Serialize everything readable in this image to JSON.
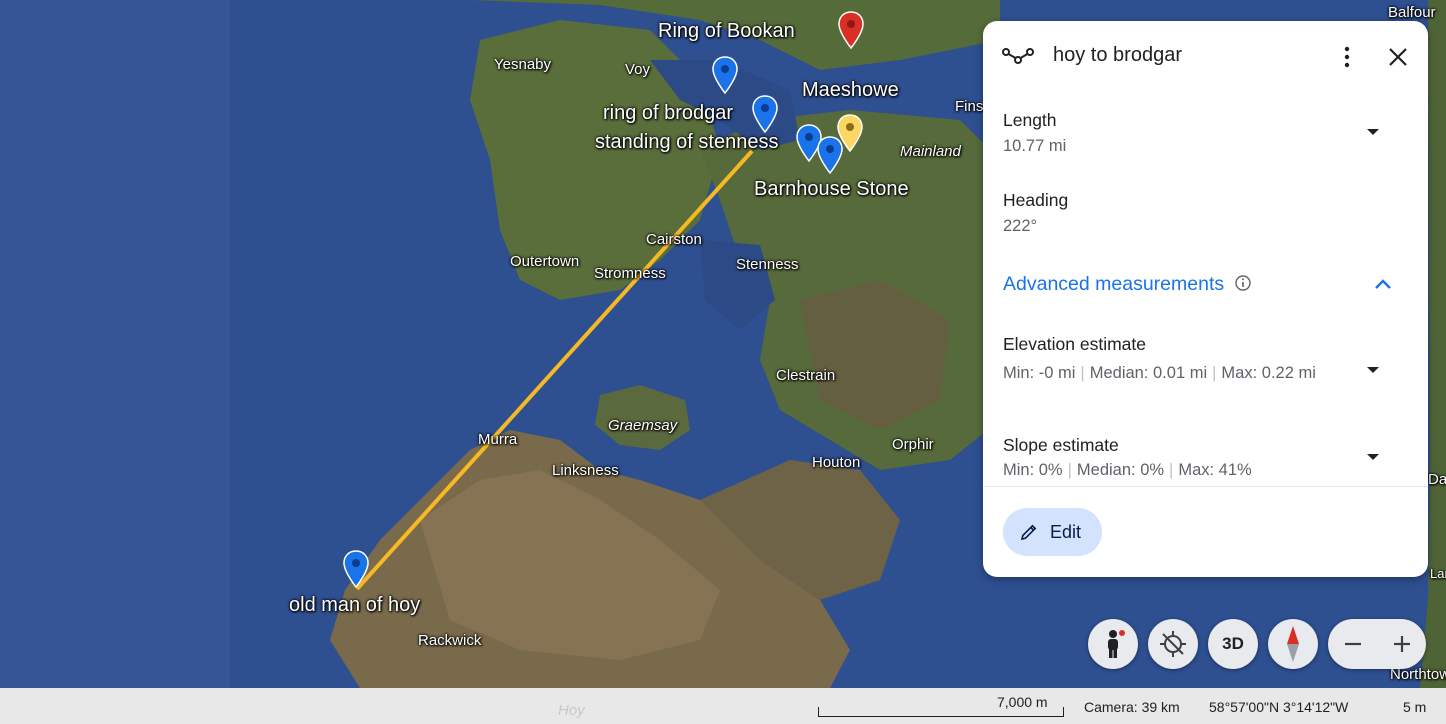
{
  "map": {
    "labels": {
      "ring_of_bookan": "Ring of Bookan",
      "balfour": "Balfour",
      "yesnaby": "Yesnaby",
      "voy": "Voy",
      "maeshowe": "Maeshowe",
      "finstown": "Fins",
      "ring_of_brodgar": "ring of brodgar",
      "standing_of_stenness": "standing of stenness",
      "mainland": "Mainland",
      "barnhouse_stone": "Barnhouse Stone",
      "cairston": "Cairston",
      "outertown": "Outertown",
      "stromness": "Stromness",
      "stenness": "Stenness",
      "clestrain": "Clestrain",
      "graemsay": "Graemsay",
      "murra": "Murra",
      "orphir": "Orphir",
      "linksness": "Linksness",
      "houton": "Houton",
      "old_man_of_hoy": "old man of hoy",
      "rackwick": "Rackwick",
      "northtown": "Northtow",
      "da": "Da",
      "lamb": "Lamb"
    },
    "pin_colors": {
      "blue": "#1a73e8",
      "red": "#d93025",
      "yellow": "#fdd663"
    },
    "path_color": "#f6b924"
  },
  "panel": {
    "title": "hoy to brodgar",
    "length_label": "Length",
    "length_value": "10.77 mi",
    "heading_label": "Heading",
    "heading_value": "222°",
    "advanced_label": "Advanced measurements",
    "elevation_label": "Elevation estimate",
    "elevation_min": "Min: -0 mi",
    "elevation_median": "Median: 0.01 mi",
    "elevation_max": "Max: 0.22 mi",
    "slope_label": "Slope estimate",
    "slope_min": "Min: 0%",
    "slope_median": "Median: 0%",
    "slope_max": "Max: 41%",
    "edit_label": "Edit"
  },
  "controls": {
    "mode_3d": "3D"
  },
  "status": {
    "scale": "7,000 m",
    "camera": "Camera: 39 km",
    "coordinates": "58°57'00\"N 3°14'12\"W",
    "elevation": "5 m",
    "hoy": "Hoy"
  }
}
